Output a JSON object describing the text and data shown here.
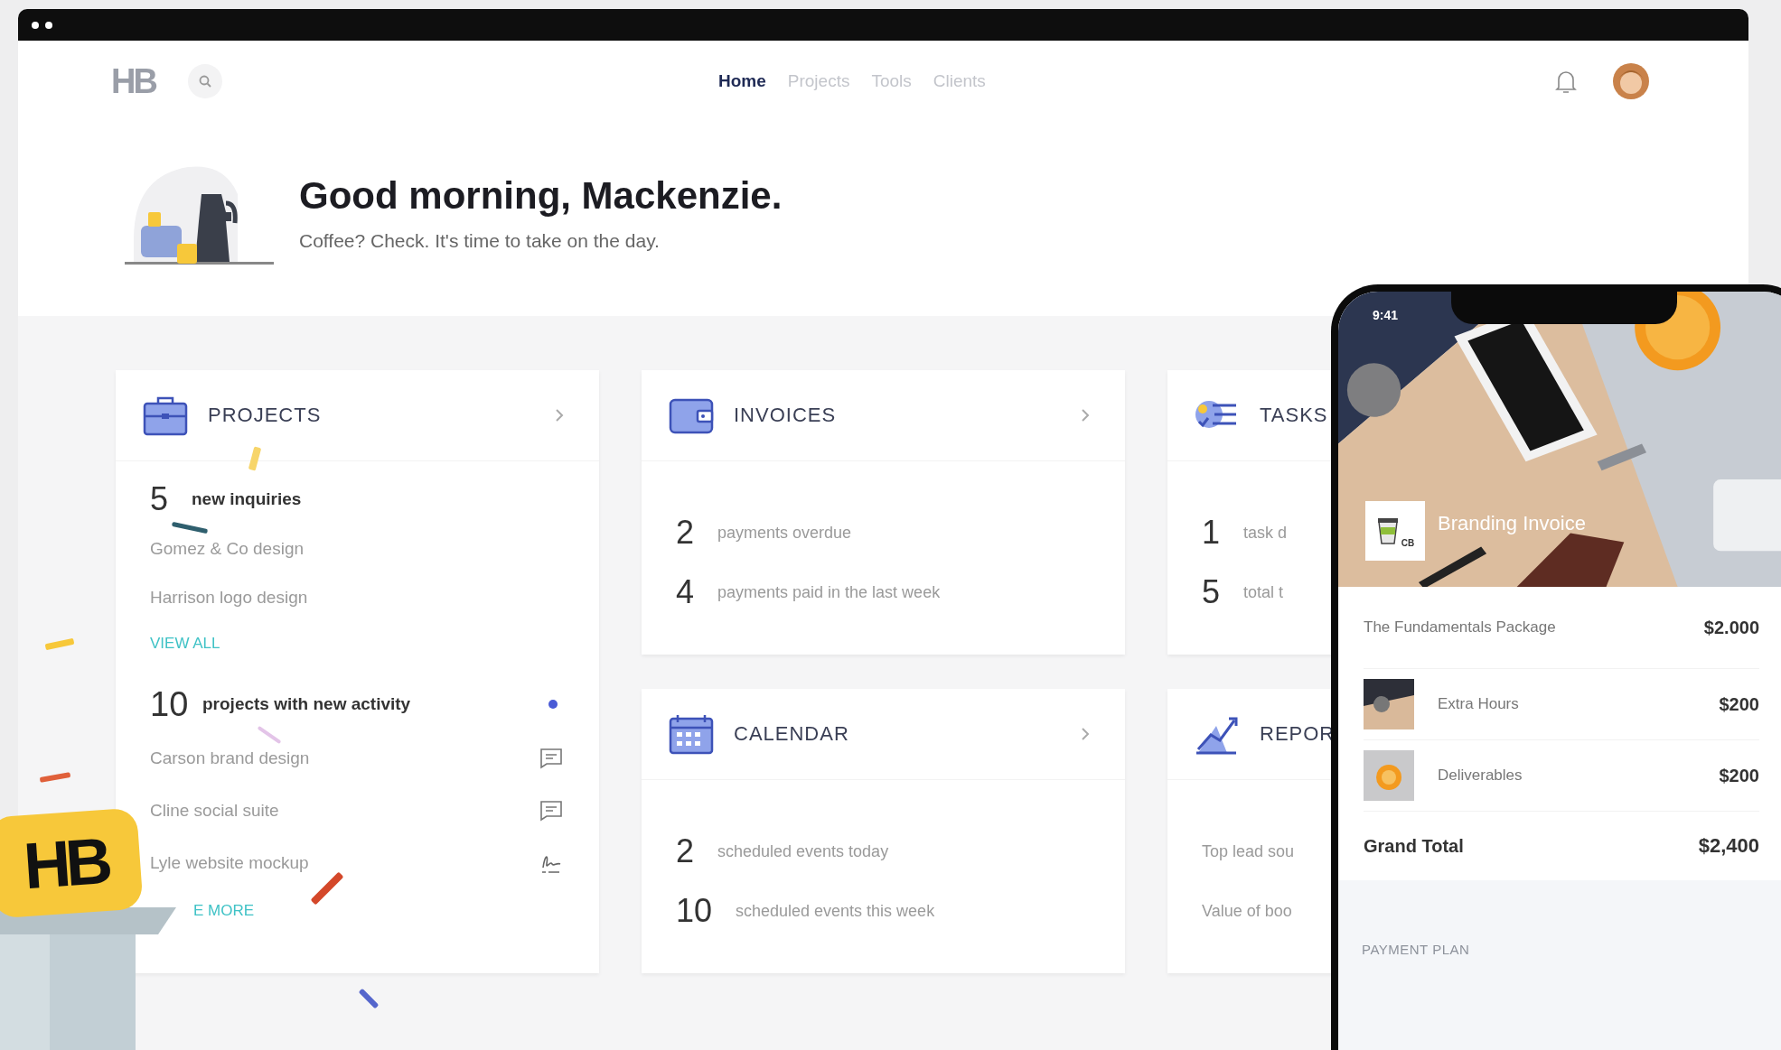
{
  "nav": {
    "logo": "HB",
    "links": [
      {
        "label": "Home",
        "selected": true
      },
      {
        "label": "Projects",
        "selected": false
      },
      {
        "label": "Tools",
        "selected": false
      },
      {
        "label": "Clients",
        "selected": false
      }
    ]
  },
  "greeting": {
    "title": "Good morning, Mackenzie.",
    "subtitle": "Coffee? Check. It's time to take on the day."
  },
  "projects": {
    "title": "PROJECTS",
    "inquiries": {
      "count": "5",
      "label": "new inquiries",
      "items": [
        "Gomez & Co design",
        "Harrison logo design"
      ]
    },
    "view_all": "VIEW ALL",
    "activity": {
      "count": "10",
      "label": "projects with new activity",
      "unread": true,
      "items": [
        {
          "name": "Carson brand design",
          "kind": "comment"
        },
        {
          "name": "Cline social suite",
          "kind": "comment"
        },
        {
          "name": "Lyle website mockup",
          "kind": "signature"
        }
      ]
    },
    "more": "E MORE"
  },
  "cards": [
    {
      "kind": "wallet",
      "title": "INVOICES",
      "arrow": true,
      "stats": [
        {
          "count": "2",
          "label": "payments overdue"
        },
        {
          "count": "4",
          "label": "payments paid in the last week"
        }
      ]
    },
    {
      "kind": "checklist",
      "title": "TASKS",
      "arrow": false,
      "stats": [
        {
          "count": "1",
          "label": "task d"
        },
        {
          "count": "5",
          "label": "total t"
        }
      ]
    },
    {
      "kind": "calendar",
      "title": "CALENDAR",
      "arrow": true,
      "stats": [
        {
          "count": "2",
          "label": "scheduled events today"
        },
        {
          "count": "10",
          "label": "scheduled events this week"
        }
      ]
    },
    {
      "kind": "chart",
      "title": "REPOR",
      "arrow": false,
      "stats": [
        {
          "label": "Top lead sou"
        },
        {
          "label": "Value of boo"
        }
      ]
    }
  ],
  "badge": {
    "logo": "HB"
  },
  "phone": {
    "time": "9:41",
    "client_logo": "CB",
    "invoice_title": "Branding Invoice",
    "lines": [
      {
        "kind": "plain",
        "name": "The Fundamentals Package",
        "price": "$2.000"
      },
      {
        "kind": "thumb",
        "name": "Extra Hours",
        "price": "$200"
      },
      {
        "kind": "thumb",
        "name": "Deliverables",
        "price": "$200"
      },
      {
        "kind": "total",
        "name": "Grand Total",
        "price": "$2,400"
      }
    ],
    "section": "PAYMENT PLAN"
  }
}
